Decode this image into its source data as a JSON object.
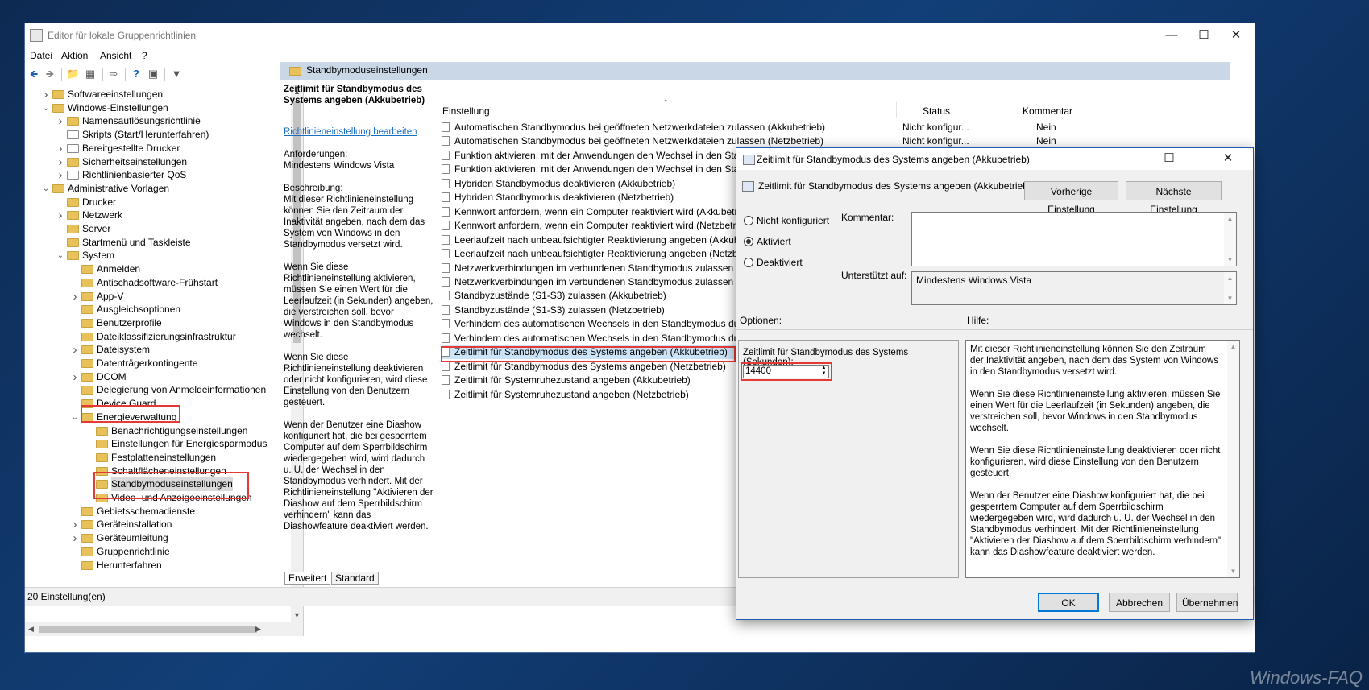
{
  "window": {
    "title": "Editor für lokale Gruppenrichtlinien",
    "controls": [
      "minimize-icon",
      "maximize-icon",
      "close-icon"
    ]
  },
  "menu": [
    "Datei",
    "Aktion",
    "Ansicht",
    "?"
  ],
  "toolbar_icons": [
    "back-icon",
    "forward-icon",
    "folder-up-icon",
    "show-hide-tree-icon",
    "export-icon",
    "help-icon",
    "properties-icon",
    "filter-icon"
  ],
  "tree": [
    {
      "label": "Softwareeinstellungen",
      "indent": 1,
      "arrow": "right",
      "icon": "folder"
    },
    {
      "label": "Windows-Einstellungen",
      "indent": 1,
      "arrow": "down",
      "icon": "folder"
    },
    {
      "label": "Namensauflösungsrichtlinie",
      "indent": 2,
      "arrow": "right",
      "icon": "folder"
    },
    {
      "label": "Skripts (Start/Herunterfahren)",
      "indent": 2,
      "arrow": "",
      "icon": "doc"
    },
    {
      "label": "Bereitgestellte Drucker",
      "indent": 2,
      "arrow": "right",
      "icon": "doc"
    },
    {
      "label": "Sicherheitseinstellungen",
      "indent": 2,
      "arrow": "right",
      "icon": "folder"
    },
    {
      "label": "Richtlinienbasierter QoS",
      "indent": 2,
      "arrow": "right",
      "icon": "doc"
    },
    {
      "label": "Administrative Vorlagen",
      "indent": 1,
      "arrow": "down",
      "icon": "folder"
    },
    {
      "label": "Drucker",
      "indent": 2,
      "arrow": "",
      "icon": "folder"
    },
    {
      "label": "Netzwerk",
      "indent": 2,
      "arrow": "right",
      "icon": "folder"
    },
    {
      "label": "Server",
      "indent": 2,
      "arrow": "",
      "icon": "folder"
    },
    {
      "label": "Startmenü und Taskleiste",
      "indent": 2,
      "arrow": "",
      "icon": "folder"
    },
    {
      "label": "System",
      "indent": 2,
      "arrow": "down",
      "icon": "folder"
    },
    {
      "label": "Anmelden",
      "indent": 3,
      "arrow": "",
      "icon": "folder"
    },
    {
      "label": "Antischadsoftware-Frühstart",
      "indent": 3,
      "arrow": "",
      "icon": "folder"
    },
    {
      "label": "App-V",
      "indent": 3,
      "arrow": "right",
      "icon": "folder"
    },
    {
      "label": "Ausgleichsoptionen",
      "indent": 3,
      "arrow": "",
      "icon": "folder"
    },
    {
      "label": "Benutzerprofile",
      "indent": 3,
      "arrow": "",
      "icon": "folder"
    },
    {
      "label": "Dateiklassifizierungsinfrastruktur",
      "indent": 3,
      "arrow": "",
      "icon": "folder"
    },
    {
      "label": "Dateisystem",
      "indent": 3,
      "arrow": "right",
      "icon": "folder"
    },
    {
      "label": "Datenträgerkontingente",
      "indent": 3,
      "arrow": "",
      "icon": "folder"
    },
    {
      "label": "DCOM",
      "indent": 3,
      "arrow": "right",
      "icon": "folder"
    },
    {
      "label": "Delegierung von Anmeldeinformationen",
      "indent": 3,
      "arrow": "",
      "icon": "folder"
    },
    {
      "label": "Device Guard",
      "indent": 3,
      "arrow": "",
      "icon": "folder"
    },
    {
      "label": "Energieverwaltung",
      "indent": 3,
      "arrow": "down",
      "icon": "folder"
    },
    {
      "label": "Benachrichtigungseinstellungen",
      "indent": 4,
      "arrow": "",
      "icon": "folder"
    },
    {
      "label": "Einstellungen für Energiesparmodus",
      "indent": 4,
      "arrow": "",
      "icon": "folder"
    },
    {
      "label": "Festplatteneinstellungen",
      "indent": 4,
      "arrow": "",
      "icon": "folder"
    },
    {
      "label": "Schaltflächeneinstellungen",
      "indent": 4,
      "arrow": "",
      "icon": "folder"
    },
    {
      "label": "Standbymoduseinstellungen",
      "indent": 4,
      "arrow": "",
      "icon": "folder",
      "selected": true
    },
    {
      "label": "Video- und Anzeigeeinstellungen",
      "indent": 4,
      "arrow": "",
      "icon": "folder"
    },
    {
      "label": "Gebietsschemadienste",
      "indent": 3,
      "arrow": "",
      "icon": "folder"
    },
    {
      "label": "Geräteinstallation",
      "indent": 3,
      "arrow": "right",
      "icon": "folder"
    },
    {
      "label": "Geräteumleitung",
      "indent": 3,
      "arrow": "right",
      "icon": "folder"
    },
    {
      "label": "Gruppenrichtlinie",
      "indent": 3,
      "arrow": "",
      "icon": "folder"
    },
    {
      "label": "Herunterfahren",
      "indent": 3,
      "arrow": "",
      "icon": "folder"
    }
  ],
  "right": {
    "header": "Standbymoduseinstellungen",
    "desc_title": "Zeitlimit für Standbymodus des Systems angeben (Akkubetrieb)",
    "desc_link": "Richtlinieneinstellung bearbeiten",
    "desc_requirements_label": "Anforderungen:",
    "desc_requirements": "Mindestens Windows Vista",
    "desc_label": "Beschreibung:",
    "desc_p1": "Mit dieser Richtlinieneinstellung können Sie den Zeitraum der Inaktivität angeben, nach dem das System von Windows in den Standbymodus versetzt wird.",
    "desc_p2": "Wenn Sie diese Richtlinieneinstellung aktivieren, müssen Sie einen Wert für die Leerlaufzeit (in Sekunden) angeben, die verstreichen soll, bevor Windows in den Standbymodus wechselt.",
    "desc_p3": "Wenn Sie diese Richtlinieneinstellung deaktivieren oder nicht konfigurieren, wird diese Einstellung von den Benutzern gesteuert.",
    "desc_p4": "Wenn der Benutzer eine Diashow konfiguriert hat, die bei gesperrtem Computer auf dem Sperrbildschirm wiedergegeben wird, wird dadurch u. U. der Wechsel in den Standbymodus verhindert.  Mit der Richtlinieneinstellung \"Aktivieren der Diashow auf dem Sperrbildschirm verhindern\" kann das Diashowfeature deaktiviert werden.",
    "columns": {
      "setting": "Einstellung",
      "status": "Status",
      "comment": "Kommentar"
    },
    "rows": [
      {
        "name": "Automatischen Standbymodus bei geöffneten Netzwerkdateien zulassen (Akkubetrieb)",
        "status": "Nicht konfigur...",
        "comment": "Nein"
      },
      {
        "name": "Automatischen Standbymodus bei geöffneten Netzwerkdateien zulassen (Netzbetrieb)",
        "status": "Nicht konfigur...",
        "comment": "Nein"
      },
      {
        "name": "Funktion aktivieren, mit der Anwendungen den Wechsel in den Standby",
        "status": "",
        "comment": ""
      },
      {
        "name": "Funktion aktivieren, mit der Anwendungen den Wechsel in den Standby",
        "status": "",
        "comment": ""
      },
      {
        "name": "Hybriden Standbymodus deaktivieren (Akkubetrieb)",
        "status": "",
        "comment": ""
      },
      {
        "name": "Hybriden Standbymodus deaktivieren (Netzbetrieb)",
        "status": "",
        "comment": ""
      },
      {
        "name": "Kennwort anfordern, wenn ein Computer reaktiviert wird (Akkubetrieb)",
        "status": "",
        "comment": ""
      },
      {
        "name": "Kennwort anfordern, wenn ein Computer reaktiviert wird (Netzbetrieb)",
        "status": "",
        "comment": ""
      },
      {
        "name": "Leerlaufzeit nach unbeaufsichtigter Reaktivierung angeben (Akkubetriet",
        "status": "",
        "comment": ""
      },
      {
        "name": "Leerlaufzeit nach unbeaufsichtigter Reaktivierung angeben (Netzbetrieb",
        "status": "",
        "comment": ""
      },
      {
        "name": "Netzwerkverbindungen im verbundenen Standbymodus zulassen (Akku",
        "status": "",
        "comment": ""
      },
      {
        "name": "Netzwerkverbindungen im verbundenen Standbymodus zulassen (Netzb",
        "status": "",
        "comment": ""
      },
      {
        "name": "Standbyzustände (S1-S3) zulassen (Akkubetrieb)",
        "status": "",
        "comment": ""
      },
      {
        "name": "Standbyzustände (S1-S3) zulassen (Netzbetrieb)",
        "status": "",
        "comment": ""
      },
      {
        "name": "Verhindern des automatischen Wechsels in den Standbymodus durch A",
        "status": "",
        "comment": ""
      },
      {
        "name": "Verhindern des automatischen Wechsels in den Standbymodus durch A",
        "status": "",
        "comment": ""
      },
      {
        "name": "Zeitlimit für Standbymodus des Systems angeben (Akkubetrieb)",
        "status": "",
        "comment": "",
        "selected": true
      },
      {
        "name": "Zeitlimit für Standbymodus des Systems angeben (Netzbetrieb)",
        "status": "",
        "comment": ""
      },
      {
        "name": "Zeitlimit für Systemruhezustand angeben (Akkubetrieb)",
        "status": "",
        "comment": ""
      },
      {
        "name": "Zeitlimit für Systemruhezustand angeben (Netzbetrieb)",
        "status": "",
        "comment": ""
      }
    ],
    "tabs": [
      "Erweitert",
      "Standard"
    ]
  },
  "status_bar": "20 Einstellung(en)",
  "dialog": {
    "title": "Zeitlimit für Standbymodus des Systems angeben (Akkubetrieb)",
    "subtitle": "Zeitlimit für Standbymodus des Systems angeben (Akkubetrieb)",
    "prev_button": "Vorherige Einstellung",
    "next_button": "Nächste Einstellung",
    "radio_not_configured": "Nicht konfiguriert",
    "radio_enabled": "Aktiviert",
    "radio_disabled": "Deaktiviert",
    "selected_radio": "Aktiviert",
    "comment_label": "Kommentar:",
    "supported_label": "Unterstützt auf:",
    "supported_value": "Mindestens Windows Vista",
    "options_label": "Optionen:",
    "help_label": "Hilfe:",
    "option_field_label": "Zeitlimit für Standbymodus des Systems (Sekunden):",
    "option_field_value": "14400",
    "help_p1": "Mit dieser Richtlinieneinstellung können Sie den Zeitraum der Inaktivität angeben, nach dem das System von Windows in den Standbymodus versetzt wird.",
    "help_p2": "Wenn Sie diese Richtlinieneinstellung aktivieren, müssen Sie einen Wert für die Leerlaufzeit (in Sekunden) angeben, die verstreichen soll, bevor Windows in den Standbymodus wechselt.",
    "help_p3": "Wenn Sie diese Richtlinieneinstellung deaktivieren oder nicht konfigurieren, wird diese Einstellung von den Benutzern gesteuert.",
    "help_p4": "Wenn der Benutzer eine Diashow konfiguriert hat, die bei gesperrtem Computer auf dem Sperrbildschirm wiedergegeben wird, wird dadurch u. U. der Wechsel in den Standbymodus verhindert.  Mit der Richtlinieneinstellung \"Aktivieren der Diashow auf dem Sperrbildschirm verhindern\" kann das Diashowfeature deaktiviert werden.",
    "ok": "OK",
    "cancel": "Abbrechen",
    "apply": "Übernehmen"
  },
  "watermark": "Windows-FAQ",
  "colors": {
    "highlight": "#e53935",
    "link": "#1a6ec2",
    "header_band": "#c9d7e7",
    "desktop": "#123f78"
  }
}
